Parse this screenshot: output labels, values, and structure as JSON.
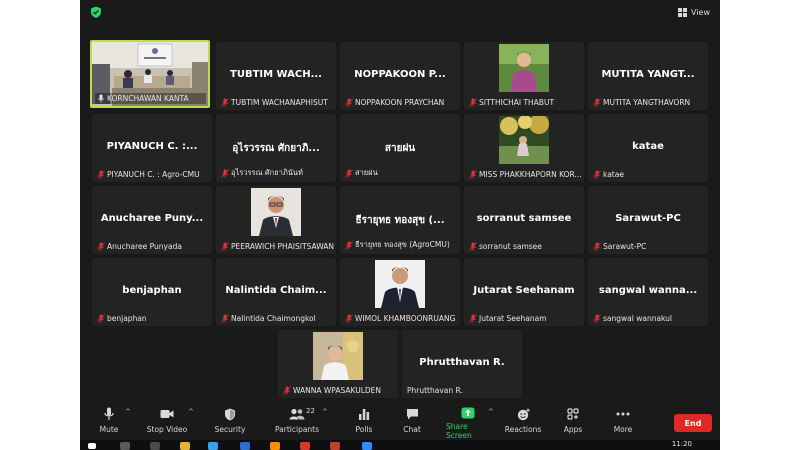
{
  "header": {
    "view_label": "View"
  },
  "tiles": [
    {
      "label": "KORNCHAWAN KANTA",
      "heading": ""
    },
    {
      "label": "TUBTIM WACHANAPHISUT",
      "heading": "TUBTIM  WACH..."
    },
    {
      "label": "NOPPAKOON PRAYCHAN",
      "heading": "NOPPAKOON  P..."
    },
    {
      "label": "SITTHICHAI THABUT",
      "heading": ""
    },
    {
      "label": "MUTITA YANGTHAVORN",
      "heading": "MUTITA  YANGT..."
    },
    {
      "label": "PIYANUCH C. :  Agro-CMU",
      "heading": "PIYANUCH  C.  :..."
    },
    {
      "label": "อุไรวรรณ ศักยาภินันท์",
      "heading": "อุไรวรรณ  ศักยาภิ..."
    },
    {
      "label": "สายฝน",
      "heading": "สายฝน"
    },
    {
      "label": "MISS PHAKKHAPORN KOR...",
      "heading": ""
    },
    {
      "label": "katae",
      "heading": "katae"
    },
    {
      "label": "Anucharee Punyada",
      "heading": "Anucharee  Puny..."
    },
    {
      "label": "PEERAWICH PHAISITSAWAN",
      "heading": ""
    },
    {
      "label": "ธีรายุทธ ทองสุข (AgroCMU)",
      "heading": "ธีรายุทธ  ทองสุข  (..."
    },
    {
      "label": "sorranut samsee",
      "heading": "sorranut  samsee"
    },
    {
      "label": "Sarawut-PC",
      "heading": "Sarawut-PC"
    },
    {
      "label": "benjaphan",
      "heading": "benjaphan"
    },
    {
      "label": "Nalintida Chaimongkol",
      "heading": "Nalintida  Chaim..."
    },
    {
      "label": "WIMOL KHAMBOONRUANG",
      "heading": ""
    },
    {
      "label": "Jutarat Seehanam",
      "heading": "Jutarat  Seehanam"
    },
    {
      "label": "sangwal wannakul",
      "heading": "sangwal  wanna..."
    },
    {
      "label": "WANNA WPASAKULDEN",
      "heading": ""
    },
    {
      "label": "Phrutthavan R.",
      "heading": "Phrutthavan  R."
    }
  ],
  "toolbar": {
    "mute": "Mute",
    "stop_video": "Stop Video",
    "security": "Security",
    "participants": "Participants",
    "participants_count": "22",
    "polls": "Polls",
    "chat": "Chat",
    "share_screen": "Share Screen",
    "reactions": "Reactions",
    "apps": "Apps",
    "more": "More",
    "end": "End"
  },
  "taskbar": {
    "time": "11:20"
  },
  "colors": {
    "background": "#1a1a1a",
    "tile": "#232323",
    "active_border": "#b8e04a",
    "share_green": "#2fd36b",
    "end_red": "#e02828",
    "muted_red": "#e0323a"
  }
}
